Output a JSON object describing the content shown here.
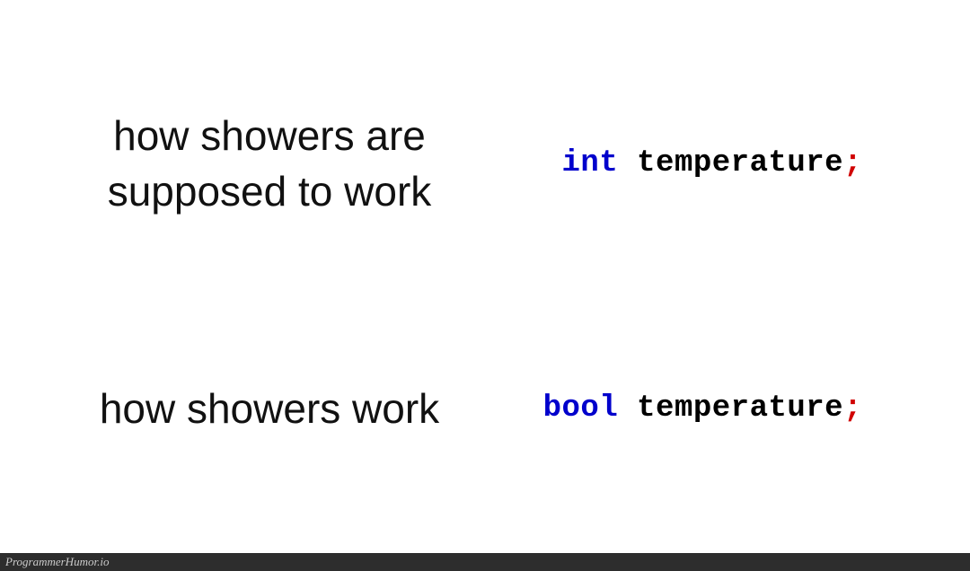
{
  "row1": {
    "caption": "how showers are supposed to work",
    "keyword": "int",
    "identifier": " temperature",
    "semicolon": ";"
  },
  "row2": {
    "caption": "how showers work",
    "keyword": "bool",
    "identifier": " temperature",
    "semicolon": ";"
  },
  "footer": "ProgrammerHumor.io"
}
